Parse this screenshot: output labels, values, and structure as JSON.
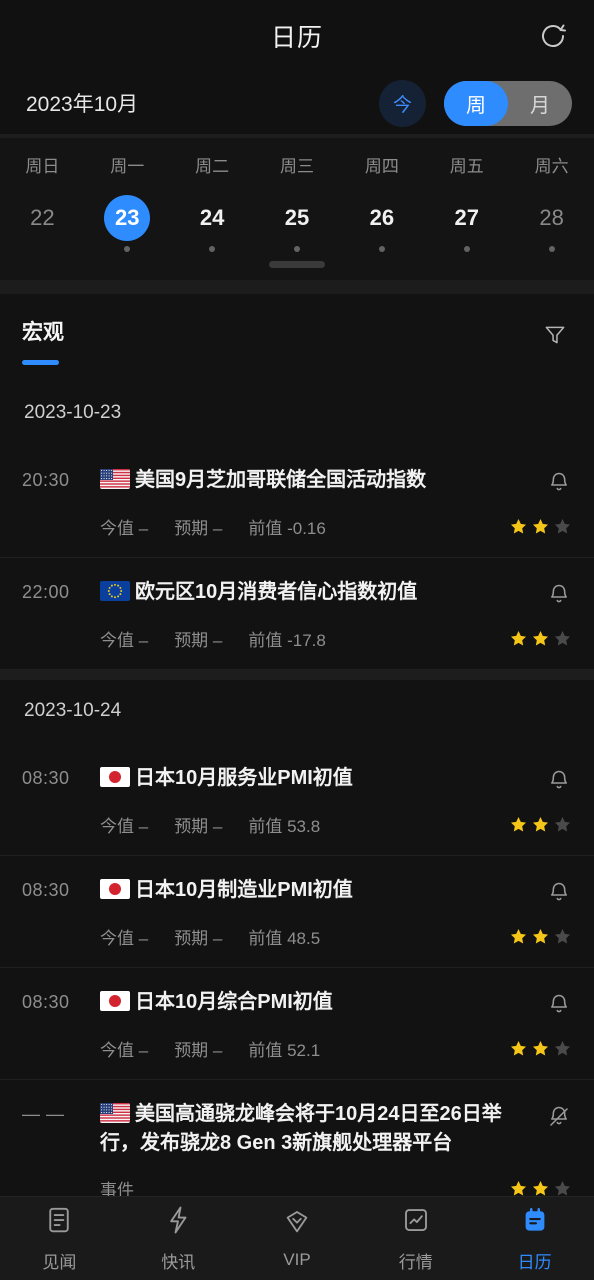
{
  "colors": {
    "accent": "#2f8cff",
    "star_filled": "#f5c518",
    "star_empty": "#4a4a4a",
    "background": "#121212",
    "muted_text": "#8e8e8e"
  },
  "header": {
    "title": "日历",
    "refresh_icon": "refresh-icon"
  },
  "monthbar": {
    "month_label": "2023年10月",
    "today_label": "今",
    "segments": [
      {
        "label": "周",
        "active": true
      },
      {
        "label": "月",
        "active": false
      }
    ]
  },
  "week": {
    "weekdays": [
      "周日",
      "周一",
      "周二",
      "周三",
      "周四",
      "周五",
      "周六"
    ],
    "days": [
      {
        "num": "22",
        "selected": false,
        "muted": true,
        "dot": false
      },
      {
        "num": "23",
        "selected": true,
        "muted": false,
        "dot": true
      },
      {
        "num": "24",
        "selected": false,
        "muted": false,
        "dot": true
      },
      {
        "num": "25",
        "selected": false,
        "muted": false,
        "dot": true
      },
      {
        "num": "26",
        "selected": false,
        "muted": false,
        "dot": true
      },
      {
        "num": "27",
        "selected": false,
        "muted": false,
        "dot": true
      },
      {
        "num": "28",
        "selected": false,
        "muted": true,
        "dot": true
      }
    ]
  },
  "category": {
    "tab_label": "宏观",
    "filter_icon": "filter-icon"
  },
  "groups": [
    {
      "date": "2023-10-23",
      "events": [
        {
          "time": "20:30",
          "flag": "us-flag",
          "title": "美国9月芝加哥联储全国活动指数",
          "bell_icon": "bell-icon",
          "bell_muted": false,
          "meta": [
            "今值 –",
            "预期 –",
            "前值 -0.16"
          ],
          "stars": 2,
          "stars_total": 3
        },
        {
          "time": "22:00",
          "flag": "eu-flag",
          "title": "欧元区10月消费者信心指数初值",
          "bell_icon": "bell-icon",
          "bell_muted": false,
          "meta": [
            "今值 –",
            "预期 –",
            "前值 -17.8"
          ],
          "stars": 2,
          "stars_total": 3
        }
      ]
    },
    {
      "date": "2023-10-24",
      "events": [
        {
          "time": "08:30",
          "flag": "jp-flag",
          "title": "日本10月服务业PMI初值",
          "bell_icon": "bell-icon",
          "bell_muted": false,
          "meta": [
            "今值 –",
            "预期 –",
            "前值 53.8"
          ],
          "stars": 2,
          "stars_total": 3
        },
        {
          "time": "08:30",
          "flag": "jp-flag",
          "title": "日本10月制造业PMI初值",
          "bell_icon": "bell-icon",
          "bell_muted": false,
          "meta": [
            "今值 –",
            "预期 –",
            "前值 48.5"
          ],
          "stars": 2,
          "stars_total": 3
        },
        {
          "time": "08:30",
          "flag": "jp-flag",
          "title": "日本10月综合PMI初值",
          "bell_icon": "bell-icon",
          "bell_muted": false,
          "meta": [
            "今值 –",
            "预期 –",
            "前值 52.1"
          ],
          "stars": 2,
          "stars_total": 3
        },
        {
          "time": "— —",
          "flag": "us-flag",
          "title": "美国高通骁龙峰会将于10月24日至26日举行，发布骁龙8 Gen 3新旗舰处理器平台",
          "bell_icon": "bell-off-icon",
          "bell_muted": true,
          "meta": [
            "事件"
          ],
          "stars": 2,
          "stars_total": 3
        }
      ]
    }
  ],
  "tabbar": [
    {
      "label": "见闻",
      "icon": "news-icon",
      "active": false
    },
    {
      "label": "快讯",
      "icon": "flash-icon",
      "active": false
    },
    {
      "label": "VIP",
      "icon": "diamond-icon",
      "active": false
    },
    {
      "label": "行情",
      "icon": "market-icon",
      "active": false
    },
    {
      "label": "日历",
      "icon": "calendar-icon",
      "active": true
    }
  ]
}
